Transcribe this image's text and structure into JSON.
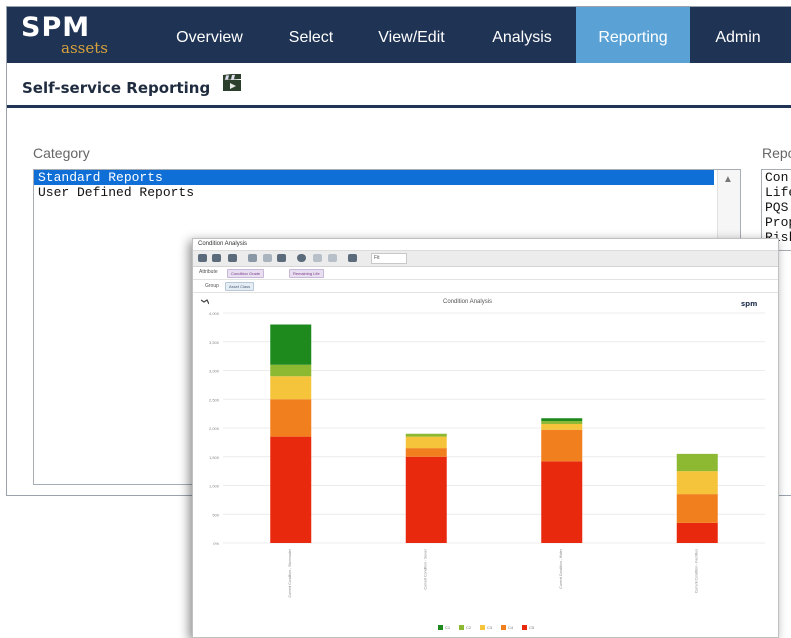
{
  "nav": {
    "logo_text": "SPM",
    "logo_sub": "assets",
    "items": [
      {
        "label": "Overview",
        "active": false
      },
      {
        "label": "Select",
        "active": false
      },
      {
        "label": "View/Edit",
        "active": false
      },
      {
        "label": "Analysis",
        "active": false
      },
      {
        "label": "Reporting",
        "active": true
      },
      {
        "label": "Admin",
        "active": false
      }
    ]
  },
  "page": {
    "title": "Self-service Reporting",
    "icon": "film-clapper-icon"
  },
  "category": {
    "label": "Category",
    "items": [
      {
        "label": "Standard Reports",
        "selected": true
      },
      {
        "label": "User Defined Reports",
        "selected": false
      }
    ]
  },
  "reports": {
    "label": "Repo",
    "items": [
      "Con",
      "Lifec",
      "PQS",
      "Prop",
      "Risk"
    ]
  },
  "chart_window": {
    "title": "Condition Analysis",
    "zoom_value": "Fit",
    "filter_label": "Attribute",
    "filter_chips": [
      "Condition Grade",
      "Remaining Life"
    ],
    "filter2_label": "Group",
    "filter2_chip": "Asset Class",
    "logo": "spm"
  },
  "chart_data": {
    "type": "bar",
    "stacked": true,
    "title": "Condition Analysis",
    "categories": [
      "Current Condition - Stormwater",
      "Current Condition - Sewer",
      "Current Condition - Water",
      "Current Condition - Facilities"
    ],
    "series": [
      {
        "name": "C5",
        "color": "#e8290e",
        "values": [
          1850,
          1500,
          1420,
          350
        ]
      },
      {
        "name": "C4",
        "color": "#f27f1e",
        "values": [
          650,
          150,
          550,
          500
        ]
      },
      {
        "name": "C3",
        "color": "#f5c43a",
        "values": [
          400,
          200,
          100,
          400
        ]
      },
      {
        "name": "C2",
        "color": "#8cb832",
        "values": [
          200,
          50,
          50,
          300
        ]
      },
      {
        "name": "C1",
        "color": "#1e8a1e",
        "values": [
          700,
          0,
          50,
          0
        ]
      }
    ],
    "ylim": [
      0,
      4000
    ],
    "y_ticks": [
      0,
      500,
      1000,
      1500,
      2000,
      2500,
      3000,
      3500,
      4000
    ],
    "y_tick_labels": [
      "0%",
      "500",
      "1,000",
      "1,500",
      "2,000",
      "2,500",
      "3,000",
      "3,500",
      "4,000"
    ],
    "legend": "bottom-center",
    "grid": true
  }
}
